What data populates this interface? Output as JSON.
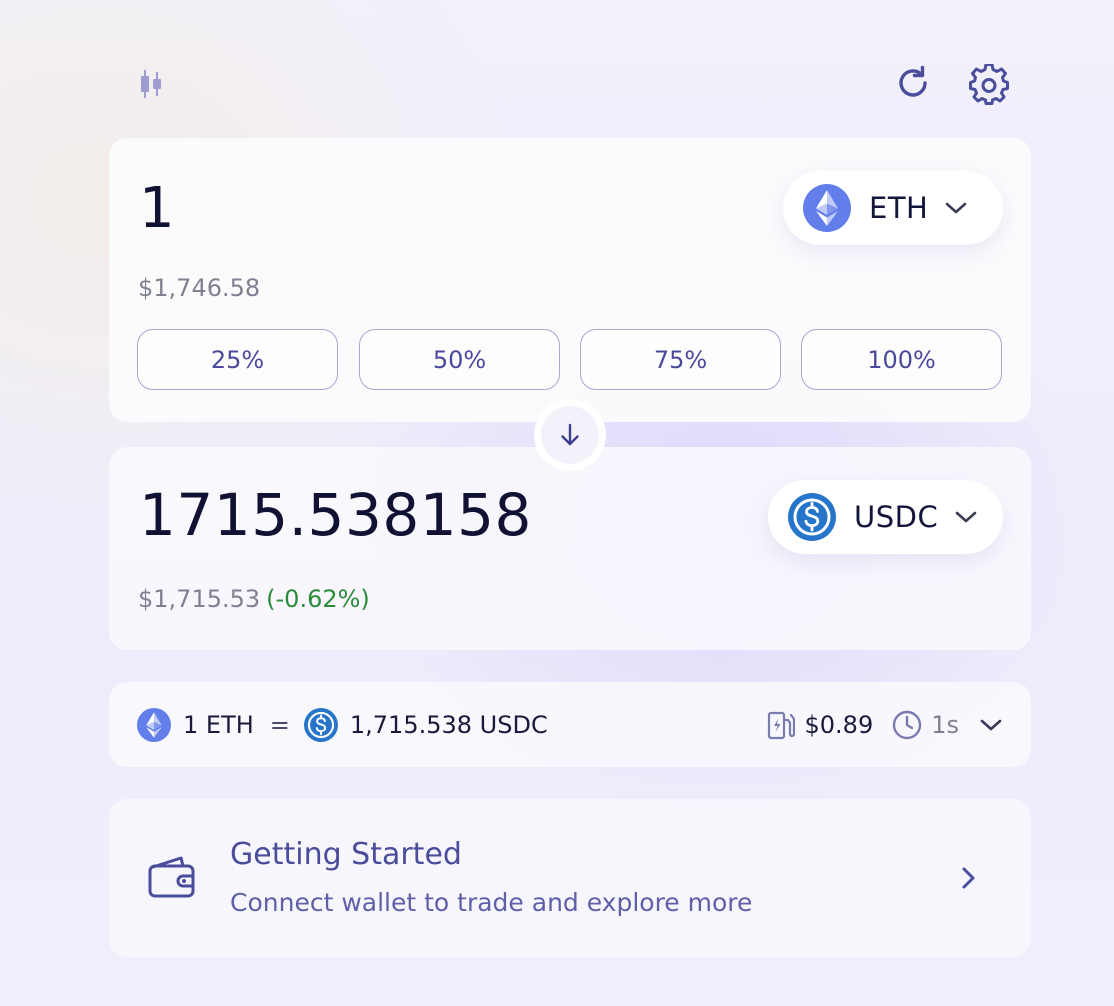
{
  "toolbar": {
    "chart_icon": "candlestick-icon",
    "refresh_icon": "refresh-icon",
    "settings_icon": "gear-icon"
  },
  "sell": {
    "amount": "1",
    "usd_value": "$1,746.58",
    "token": {
      "symbol": "ETH",
      "icon": "eth-icon",
      "color": "#627eea"
    },
    "percent_buttons": [
      "25%",
      "50%",
      "75%",
      "100%"
    ]
  },
  "switch": {
    "icon": "arrow-down-icon"
  },
  "buy": {
    "amount": "1715.538158",
    "usd_value": "$1,715.53",
    "price_impact": "(-0.62%)",
    "price_impact_color": "#2a8b3a",
    "token": {
      "symbol": "USDC",
      "icon": "usdc-icon",
      "color": "#2775ca"
    }
  },
  "rate": {
    "from": "1 ETH",
    "equals": "=",
    "to": "1,715.538 USDC",
    "gas": "$0.89",
    "gas_icon": "gas-pump-icon",
    "time": "1s",
    "time_icon": "clock-icon",
    "expand_icon": "chevron-down-icon"
  },
  "getting_started": {
    "title": "Getting Started",
    "subtitle": "Connect wallet to trade and explore more",
    "icon": "wallet-icon",
    "arrow_icon": "chevron-right-icon"
  },
  "colors": {
    "accent": "#4a4c9c",
    "text_primary": "#101133",
    "text_muted": "#7f8192"
  }
}
